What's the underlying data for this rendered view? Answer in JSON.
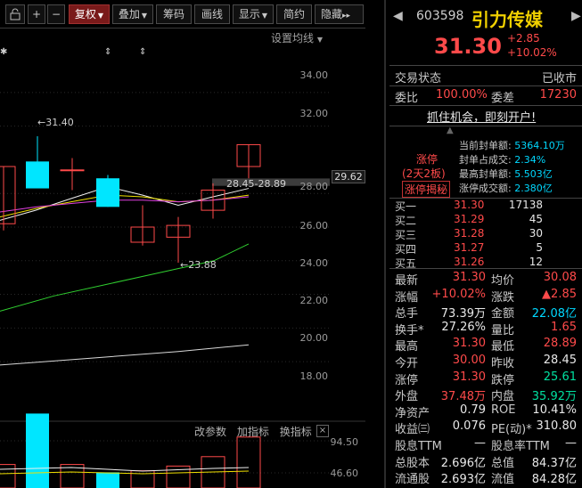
{
  "toolbar": {
    "plus": "+",
    "minus": "−",
    "fuquan": "复权",
    "diejia": "叠加",
    "chouma": "筹码",
    "huaxian": "画线",
    "xianshi": "显示",
    "jianyue": "简约",
    "yincang": "隐藏",
    "more": "▸▸"
  },
  "chart": {
    "ma_settings": "设置均线",
    "price_ticks": [
      "34.00",
      "32.00",
      "28.00",
      "26.00",
      "24.00",
      "22.00",
      "20.00",
      "18.00"
    ],
    "current_price": "29.62",
    "annotation_high": "31.40",
    "annotation_low": "23.88",
    "annotation_range": "28.45-28.89",
    "indicator_toolbar": {
      "change_params": "改参数",
      "add_indicator": "加指标",
      "switch_indicator": "换指标"
    },
    "close_symbol": "×",
    "vol_ticks": [
      "94.50",
      "46.60"
    ]
  },
  "chart_data": {
    "type": "candlestick",
    "ylim": [
      17,
      35
    ],
    "candles": [
      {
        "open": 26.2,
        "close": 29.6,
        "high": 29.6,
        "low": 25.8,
        "rise": true
      },
      {
        "open": 29.2,
        "close": 28.0,
        "high": 29.2,
        "low": 26.1,
        "rise": false
      },
      {
        "open": 29.9,
        "close": 28.3,
        "high": 31.4,
        "low": 28.3,
        "rise": false
      },
      {
        "open": 29.4,
        "close": 29.4,
        "high": 30.1,
        "low": 28.2,
        "rise": true
      },
      {
        "open": 28.9,
        "close": 27.2,
        "high": 29.1,
        "low": 27.2,
        "rise": false
      },
      {
        "open": 25.1,
        "close": 26.0,
        "high": 27.3,
        "low": 24.9,
        "rise": true
      },
      {
        "open": 25.4,
        "close": 26.1,
        "high": 26.6,
        "low": 23.88,
        "rise": true
      },
      {
        "open": 27.0,
        "close": 28.2,
        "high": 28.6,
        "low": 26.5,
        "rise": true
      },
      {
        "open": 29.6,
        "close": 30.9,
        "high": 30.9,
        "low": 28.9,
        "rise": true
      }
    ],
    "volumes": [
      30,
      55,
      95,
      30,
      20,
      22,
      28,
      40,
      65
    ]
  },
  "quote": {
    "code": "603598",
    "name": "引力传媒",
    "price": "31.30",
    "change": "+2.85",
    "change_pct": "+10.02%",
    "status_label": "交易状态",
    "status_value": "已收市",
    "weibi_label": "委比",
    "weibi_value": "100.00%",
    "weicha_label": "委差",
    "weicha_value": "17230",
    "promo": "抓住机会，即刻开户!",
    "limit_tag": "涨停",
    "limit_days": "(2天2板)",
    "limit_secret": "涨停揭秘",
    "seal_rows": [
      {
        "label": "当前封单额:",
        "value": "5364.10万"
      },
      {
        "label": "封单占成交:",
        "value": "2.34%"
      },
      {
        "label": "最高封单额:",
        "value": "5.503亿"
      },
      {
        "label": "涨停成交额:",
        "value": "2.380亿"
      }
    ],
    "bids": [
      {
        "label": "买一",
        "price": "31.30",
        "vol": "17138"
      },
      {
        "label": "买二",
        "price": "31.29",
        "vol": "45"
      },
      {
        "label": "买三",
        "price": "31.28",
        "vol": "30"
      },
      {
        "label": "买四",
        "price": "31.27",
        "vol": "5"
      },
      {
        "label": "买五",
        "price": "31.26",
        "vol": "12"
      }
    ],
    "stats": [
      {
        "l1": "最新",
        "v1": "31.30",
        "c1": "red",
        "l2": "均价",
        "v2": "30.08",
        "c2": "red"
      },
      {
        "l1": "涨幅",
        "v1": "+10.02%",
        "c1": "red",
        "l2": "涨跌",
        "v2": "▲2.85",
        "c2": "red"
      },
      {
        "l1": "总手",
        "v1": "73.39万",
        "c1": "white",
        "l2": "金额",
        "v2": "22.08亿",
        "c2": "cyan"
      },
      {
        "l1": "换手*",
        "v1": "27.26%",
        "c1": "white",
        "l2": "量比",
        "v2": "1.65",
        "c2": "red"
      },
      {
        "l1": "最高",
        "v1": "31.30",
        "c1": "red",
        "l2": "最低",
        "v2": "28.89",
        "c2": "red"
      },
      {
        "l1": "今开",
        "v1": "30.00",
        "c1": "red",
        "l2": "昨收",
        "v2": "28.45",
        "c2": "white"
      },
      {
        "l1": "涨停",
        "v1": "31.30",
        "c1": "red",
        "l2": "跌停",
        "v2": "25.61",
        "c2": "green"
      },
      {
        "l1": "外盘",
        "v1": "37.48万",
        "c1": "red",
        "l2": "内盘",
        "v2": "35.92万",
        "c2": "green"
      },
      {
        "l1": "净资产",
        "v1": "0.79",
        "c1": "white",
        "l2": "ROE",
        "v2": "10.41%",
        "c2": "white"
      },
      {
        "l1": "收益㈢",
        "v1": "0.076",
        "c1": "white",
        "l2": "PE(动)*",
        "v2": "310.80",
        "c2": "white"
      },
      {
        "l1": "股息TTM",
        "v1": "—",
        "c1": "white",
        "l2": "股息率TTM",
        "v2": "—",
        "c2": "white"
      },
      {
        "l1": "总股本",
        "v1": "2.696亿",
        "c1": "white",
        "l2": "总值",
        "v2": "84.37亿",
        "c2": "white"
      },
      {
        "l1": "流通股",
        "v1": "2.693亿",
        "c1": "white",
        "l2": "流值",
        "v2": "84.28亿",
        "c2": "white"
      }
    ]
  },
  "colors": {
    "rise": "#ff4a4a",
    "fall": "#00e6ff",
    "ma_white": "#f0f0f0",
    "ma_yellow": "#f0e000",
    "ma_magenta": "#e040e0",
    "ma_green": "#30d030"
  }
}
